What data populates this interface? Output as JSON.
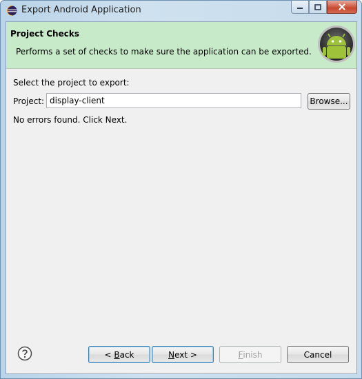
{
  "window": {
    "title": "Export Android Application",
    "minimize_label": "minimize",
    "maximize_label": "maximize",
    "close_label": "close"
  },
  "header": {
    "title": "Project Checks",
    "description": "Performs a set of checks to make sure the application can be exported."
  },
  "form": {
    "select_label": "Select the project to export:",
    "project_label": "Project:",
    "project_value": "display-client",
    "browse_label": "Browse...",
    "status": "No errors found. Click Next."
  },
  "footer": {
    "back_mnemonic": "B",
    "back_prefix": "< ",
    "back_rest": "ack",
    "next_mnemonic": "N",
    "next_rest": "ext >",
    "finish_mnemonic": "F",
    "finish_rest": "inish",
    "cancel_label": "Cancel"
  },
  "colors": {
    "header_bg": "#c7ebc9",
    "client_bg": "#f0f0f0",
    "frame": "#c6dbeb",
    "focus_border": "#3c7fb1"
  },
  "icons": [
    "eclipse-app-icon",
    "android-logo-icon",
    "help-icon"
  ]
}
